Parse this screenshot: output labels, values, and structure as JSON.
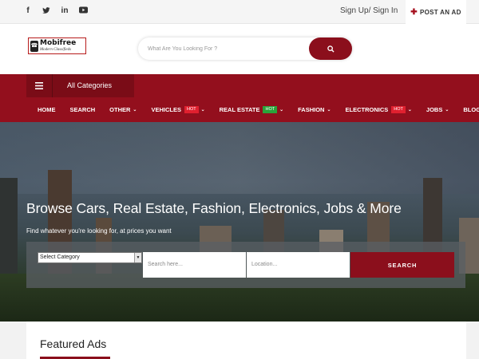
{
  "topbar": {
    "social_icons": [
      "facebook-icon",
      "twitter-icon",
      "linkedin-icon",
      "youtube-icon"
    ],
    "signin_label": "Sign Up/ Sign In",
    "post_ad_label": "POST AN AD"
  },
  "header": {
    "logo_title": "Mobifree",
    "logo_tagline": "Modern Classifieds",
    "search_placeholder": "What Are You Looking For ?"
  },
  "nav": {
    "categories_label": "All Categories",
    "items": [
      {
        "label": "HOME",
        "dropdown": false,
        "badge": ""
      },
      {
        "label": "SEARCH",
        "dropdown": false,
        "badge": ""
      },
      {
        "label": "OTHER",
        "dropdown": true,
        "badge": ""
      },
      {
        "label": "VEHICLES",
        "dropdown": true,
        "badge": "HOT",
        "badge_color": "#e0202f"
      },
      {
        "label": "REAL ESTATE",
        "dropdown": true,
        "badge": "HOT",
        "badge_color": "#2aa33a"
      },
      {
        "label": "FASHION",
        "dropdown": true,
        "badge": ""
      },
      {
        "label": "ELECTRONICS",
        "dropdown": true,
        "badge": "HOT",
        "badge_color": "#e0202f"
      },
      {
        "label": "JOBS",
        "dropdown": true,
        "badge": ""
      },
      {
        "label": "BLOG",
        "dropdown": false,
        "badge": ""
      }
    ]
  },
  "hero": {
    "headline": "Browse Cars, Real Estate, Fashion, Electronics, Jobs & More",
    "subheadline": "Find whatever you're looking for, at prices you want",
    "category_select": "Select Category",
    "search_placeholder": "Search here...",
    "location_placeholder": "Location...",
    "search_button": "SEARCH"
  },
  "featured": {
    "title": "Featured Ads"
  },
  "colors": {
    "brand": "#930f1d",
    "brand_dark": "#8b0f1c",
    "hot_red": "#e0202f",
    "hot_green": "#2aa33a"
  }
}
